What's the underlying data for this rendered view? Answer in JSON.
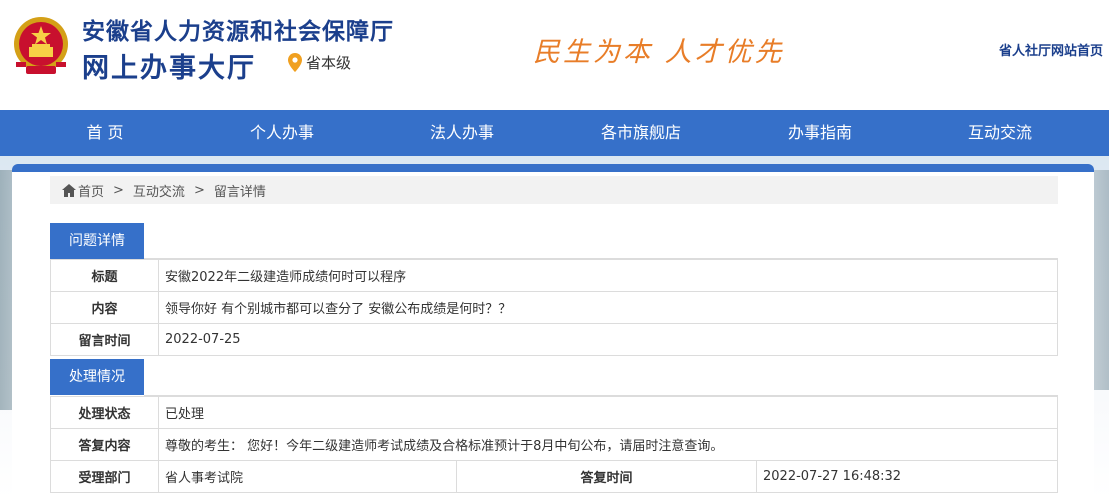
{
  "header": {
    "title_line1": "安徽省人力资源和社会保障厅",
    "title_line2": "网上办事大厅",
    "location": "省本级",
    "slogan": "民生为本 人才优先",
    "home_link": "省人社厅网站首页",
    "emblem_icon": "national-emblem",
    "location_icon": "map-pin-icon",
    "brand_color": "#1b3f8c",
    "accent_color": "#e87d28"
  },
  "nav": {
    "color": "#3670c9",
    "items": [
      "首 页",
      "个人办事",
      "法人办事",
      "各市旗舰店",
      "办事指南",
      "互动交流"
    ]
  },
  "breadcrumb": {
    "home_icon": "home-icon",
    "items": [
      "首页",
      "互动交流",
      "留言详情"
    ],
    "separator": ">"
  },
  "question": {
    "section_title": "问题详情",
    "rows": [
      {
        "label": "标题",
        "value": "安徽2022年二级建造师成绩何时可以程序"
      },
      {
        "label": "内容",
        "value": "领导你好 有个别城市都可以查分了 安徽公布成绩是何时？？"
      },
      {
        "label": "留言时间",
        "value": "2022-07-25"
      }
    ]
  },
  "handling": {
    "section_title": "处理情况",
    "status_label": "处理状态",
    "status_value": "已处理",
    "reply_label": "答复内容",
    "reply_value": "尊敬的考生： 您好！今年二级建造师考试成绩及合格标准预计于8月中旬公布，请届时注意查询。",
    "dept_label": "受理部门",
    "dept_value": "省人事考试院",
    "time_label": "答复时间",
    "time_value": "2022-07-27 16:48:32"
  }
}
